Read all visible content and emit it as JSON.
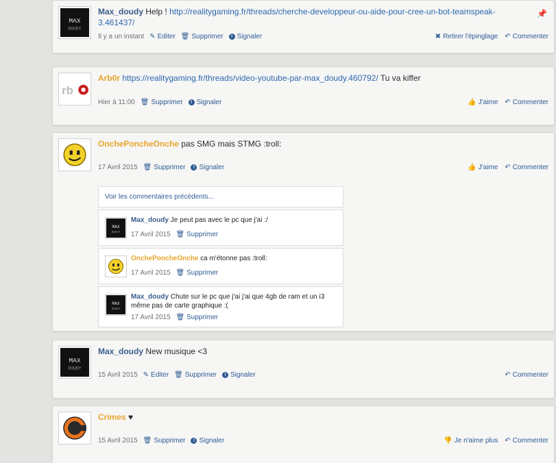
{
  "posts": [
    {
      "author": "Max_doudy",
      "text": "Help !",
      "link": "http://realitygaming.fr/threads/cherche-developpeur-ou-aide-pour-cree-un-bot-teamspeak-3.461437/",
      "date": "Il y a un instant",
      "edit": "Editer",
      "delete": "Supprimer",
      "report": "Signaler",
      "unpin": "Retirer l'épinglage",
      "comment": "Commenter"
    },
    {
      "author": "Arb0r",
      "link": "https://realitygaming.fr/threads/video-youtube-par-max_doudy.460792/",
      "text": "Tu va kiffer",
      "date": "Hier à 11:00",
      "delete": "Supprimer",
      "report": "Signaler",
      "like": "J'aime",
      "comment": "Commenter"
    },
    {
      "author": "OnchePoncheOnche",
      "text": "pas SMG mais STMG :troll:",
      "date": "17 Avril 2015",
      "delete": "Supprimer",
      "report": "Signaler",
      "like": "J'aime",
      "comment": "Commenter",
      "more_comments": "Voir les commentaires précédents...",
      "comments": [
        {
          "author": "Max_doudy",
          "text": "Je peut pas avec le pc que j'ai :/",
          "date": "17 Avril 2015",
          "delete": "Supprimer"
        },
        {
          "author": "OnchePoncheOnche",
          "text": "ca m'étonne pas :troll:",
          "date": "17 Avril 2015",
          "delete": "Supprimer"
        },
        {
          "author": "Max_doudy",
          "text": "Chute sur le pc que j'ai j'ai que 4gb de ram et un i3 même pas de carte graphique :(",
          "date": "17 Avril 2015",
          "delete": "Supprimer"
        }
      ]
    },
    {
      "author": "Max_doudy",
      "text": "New musique <3",
      "date": "15 Avril 2015",
      "edit": "Editer",
      "delete": "Supprimer",
      "report": "Signaler",
      "comment": "Commenter"
    },
    {
      "author": "Crimes",
      "text": "♥",
      "date": "15 Avril 2015",
      "delete": "Supprimer",
      "report": "Signaler",
      "unlike": "Je n'aime plus",
      "comment": "Commenter"
    }
  ],
  "icons": {
    "pin": "pin-icon",
    "edit": "pencil-icon",
    "delete": "trash-icon",
    "report": "warning-icon",
    "comment": "reply-arrow-icon",
    "like": "thumbs-up-icon",
    "unpin": "close-x-icon"
  },
  "colors": {
    "link": "#2c67ad",
    "author_blue": "#3b5c8a",
    "author_orange": "#e8a52c",
    "action": "#2d5a93",
    "background": "#e3e3e1",
    "card": "#f6f6f5"
  }
}
